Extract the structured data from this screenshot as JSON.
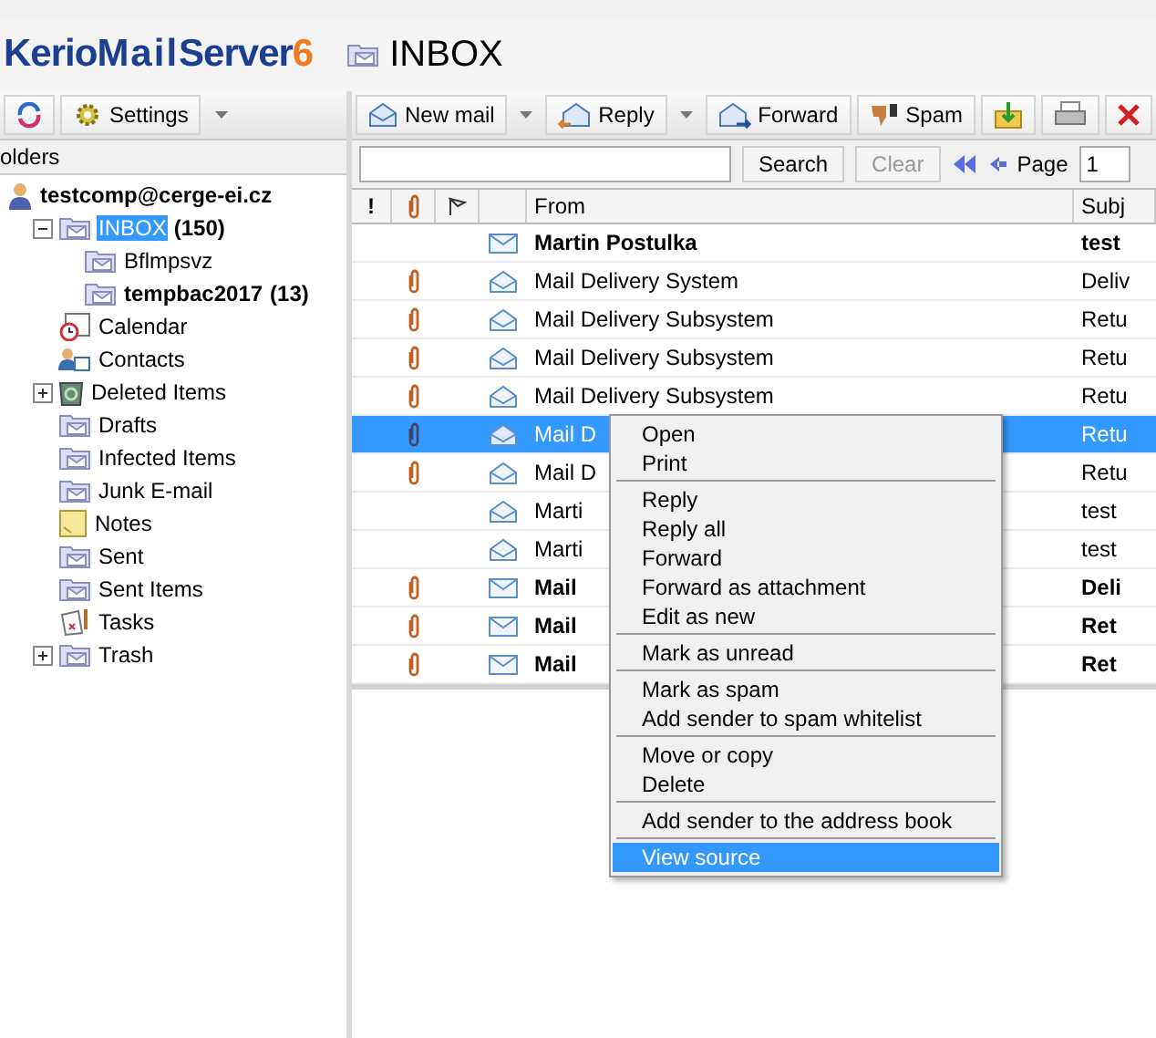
{
  "logo": {
    "part_1": "Kerio",
    "part_2": "Mail",
    "part_3": "Server",
    "part_4": "6"
  },
  "folder_title": "INBOX",
  "left_toolbar": {
    "settings": "Settings"
  },
  "folders_header": "olders",
  "tree": [
    {
      "label": "testcomp@cerge-ei.cz",
      "kind": "account",
      "bold": true,
      "children": [
        {
          "label": "INBOX",
          "count": "(150)",
          "kind": "folder",
          "selected": true,
          "expanded": true,
          "children": [
            {
              "label": "Bflmpsvz",
              "kind": "folder",
              "bold": false,
              "selected": false
            },
            {
              "label": "tempbac2017",
              "count": "(13)",
              "kind": "folder",
              "bold": true,
              "selected": false
            }
          ]
        },
        {
          "label": "Calendar",
          "kind": "calendar",
          "selected": false
        },
        {
          "label": "Contacts",
          "kind": "contacts",
          "selected": false
        },
        {
          "label": "Deleted Items",
          "kind": "bin",
          "expanded": false,
          "selected": false
        },
        {
          "label": "Drafts",
          "kind": "folder",
          "selected": false
        },
        {
          "label": "Infected Items",
          "kind": "folder",
          "selected": false
        },
        {
          "label": "Junk E-mail",
          "kind": "folder",
          "selected": false
        },
        {
          "label": "Notes",
          "kind": "notes",
          "selected": false
        },
        {
          "label": "Sent",
          "kind": "folder",
          "selected": false
        },
        {
          "label": "Sent Items",
          "kind": "folder",
          "selected": false
        },
        {
          "label": "Tasks",
          "kind": "tasks",
          "selected": false
        },
        {
          "label": "Trash",
          "kind": "folder",
          "expanded": false,
          "selected": false
        }
      ]
    }
  ],
  "toolbar": [
    {
      "kind": "new",
      "label": "New mail"
    },
    {
      "kind": "caret"
    },
    {
      "kind": "reply",
      "label": "Reply"
    },
    {
      "kind": "caret"
    },
    {
      "kind": "forward",
      "label": "Forward"
    },
    {
      "kind": "spam",
      "label": "Spam"
    },
    {
      "kind": "move"
    },
    {
      "kind": "print"
    },
    {
      "kind": "delete"
    }
  ],
  "search": {
    "button": "Search",
    "clear": {
      "label": "Clear",
      "disabled": true
    },
    "page_label": "Page",
    "page": "1"
  },
  "columns": {
    "priority": "!",
    "from": "From",
    "subject": "Subj"
  },
  "rows": [
    {
      "from": "Martin Postulka",
      "subject": "test",
      "read": false,
      "attachment": false,
      "selected": false
    },
    {
      "from": "Mail Delivery System",
      "subject": "Deliv",
      "read": true,
      "attachment": true,
      "selected": false
    },
    {
      "from": "Mail Delivery Subsystem",
      "subject": "Retu",
      "read": true,
      "attachment": true,
      "selected": false
    },
    {
      "from": "Mail Delivery Subsystem",
      "subject": "Retu",
      "read": true,
      "attachment": true,
      "selected": false
    },
    {
      "from": "Mail Delivery Subsystem",
      "subject": "Retu",
      "read": true,
      "attachment": true,
      "selected": false
    },
    {
      "from": "Mail D",
      "subject": "Retu",
      "read": true,
      "attachment": true,
      "selected": true
    },
    {
      "from": "Mail D",
      "subject": "Retu",
      "read": true,
      "attachment": true,
      "selected": false
    },
    {
      "from": "Marti",
      "subject": "test",
      "read": true,
      "attachment": false,
      "selected": false
    },
    {
      "from": "Marti",
      "subject": "test",
      "read": true,
      "attachment": false,
      "selected": false
    },
    {
      "from": "Mail",
      "subject": "Deli",
      "read": false,
      "attachment": true,
      "selected": false
    },
    {
      "from": "Mail",
      "subject": "Ret",
      "read": false,
      "attachment": true,
      "selected": false
    },
    {
      "from": "Mail",
      "subject": "Ret",
      "read": false,
      "attachment": true,
      "selected": false
    }
  ],
  "context_menu": [
    [
      {
        "label": "Open",
        "selected": false
      },
      {
        "label": "Print",
        "selected": false
      }
    ],
    [
      {
        "label": "Reply",
        "selected": false
      },
      {
        "label": "Reply all",
        "selected": false
      },
      {
        "label": "Forward",
        "selected": false
      },
      {
        "label": "Forward as attachment",
        "selected": false
      },
      {
        "label": "Edit as new",
        "selected": false
      }
    ],
    [
      {
        "label": "Mark as unread",
        "selected": false
      }
    ],
    [
      {
        "label": "Mark as spam",
        "selected": false
      },
      {
        "label": "Add sender to spam whitelist",
        "selected": false
      }
    ],
    [
      {
        "label": "Move or copy",
        "selected": false
      },
      {
        "label": "Delete",
        "selected": false
      }
    ],
    [
      {
        "label": "Add sender to the address book",
        "selected": false
      }
    ],
    [
      {
        "label": "View source",
        "selected": true
      }
    ]
  ]
}
